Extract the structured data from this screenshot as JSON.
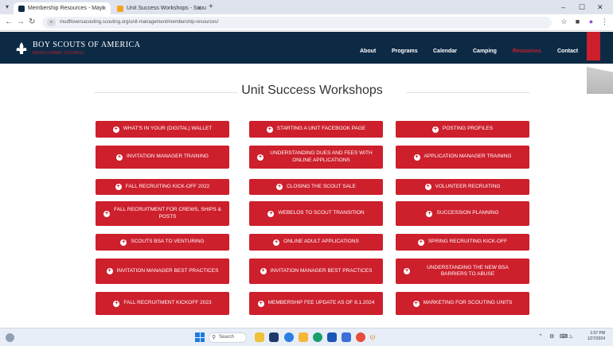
{
  "browser": {
    "tabs": [
      {
        "label": "Membership Resources - May!",
        "active": true
      },
      {
        "label": "Unit Success Workshops - Scou",
        "active": false
      }
    ],
    "address": "mudfloversacouting.scouting.org/unit-management/membership-resources/",
    "new_tab_label": "+",
    "minimize": "–",
    "maximize": "☐",
    "close": "✕"
  },
  "site": {
    "title": "BOY SCOUTS OF AMERICA",
    "subtitle": "MUDFLOWER COUNCIL",
    "nav": [
      "About",
      "Programs",
      "Calendar",
      "Camping",
      "Resources",
      "Contact"
    ],
    "active_nav": "Resources",
    "brand_color": "#cd1f2c",
    "header_color": "#0d2a45"
  },
  "page": {
    "title": "Unit Success Workshops",
    "buttons": [
      [
        "WHAT'S IN YOUR (DIGITAL) WALLET",
        "STARTING A UNIT FACEBOOK PAGE",
        "POSTING PROFILES"
      ],
      [
        "INVITATION MANAGER TRAINING",
        "UNDERSTANDING DUES AND FEES WITH ONLINE APPLICATIONS",
        "APPLICATION MANAGER TRAINING"
      ],
      [
        "FALL RECRUITING KICK-OFF 2022",
        "CLOSING THE SCOUT SALE",
        "VOLUNTEER RECRUITING"
      ],
      [
        "FALL RECRUITMENT FOR CREWS, SHIPS & POSTS",
        "WEBELOS TO SCOUT TRANSITION",
        "SUCCESSION PLANNING"
      ],
      [
        "SCOUTS BSA TO VENTURING",
        "ONLINE ADULT APPLICATIONS",
        "SPRING RECRUITING KICK-OFF"
      ],
      [
        "INVITATION MANAGER BEST PRACTICES",
        "INVITATION MANAGER BEST PRACTICES",
        "UNDERSTANDING THE NEW BSA BARRIERS TO ABUSE"
      ],
      [
        "FALL RECRUITMENT KICKOFF 2023",
        "MEMBERSHIP FEE UPDATE AS OF 8.1.2024",
        "MARKETING FOR SCOUTING UNITS"
      ]
    ]
  },
  "taskbar": {
    "search_placeholder": "Search",
    "time": "1:07 PM",
    "date": "1/27/2024"
  }
}
